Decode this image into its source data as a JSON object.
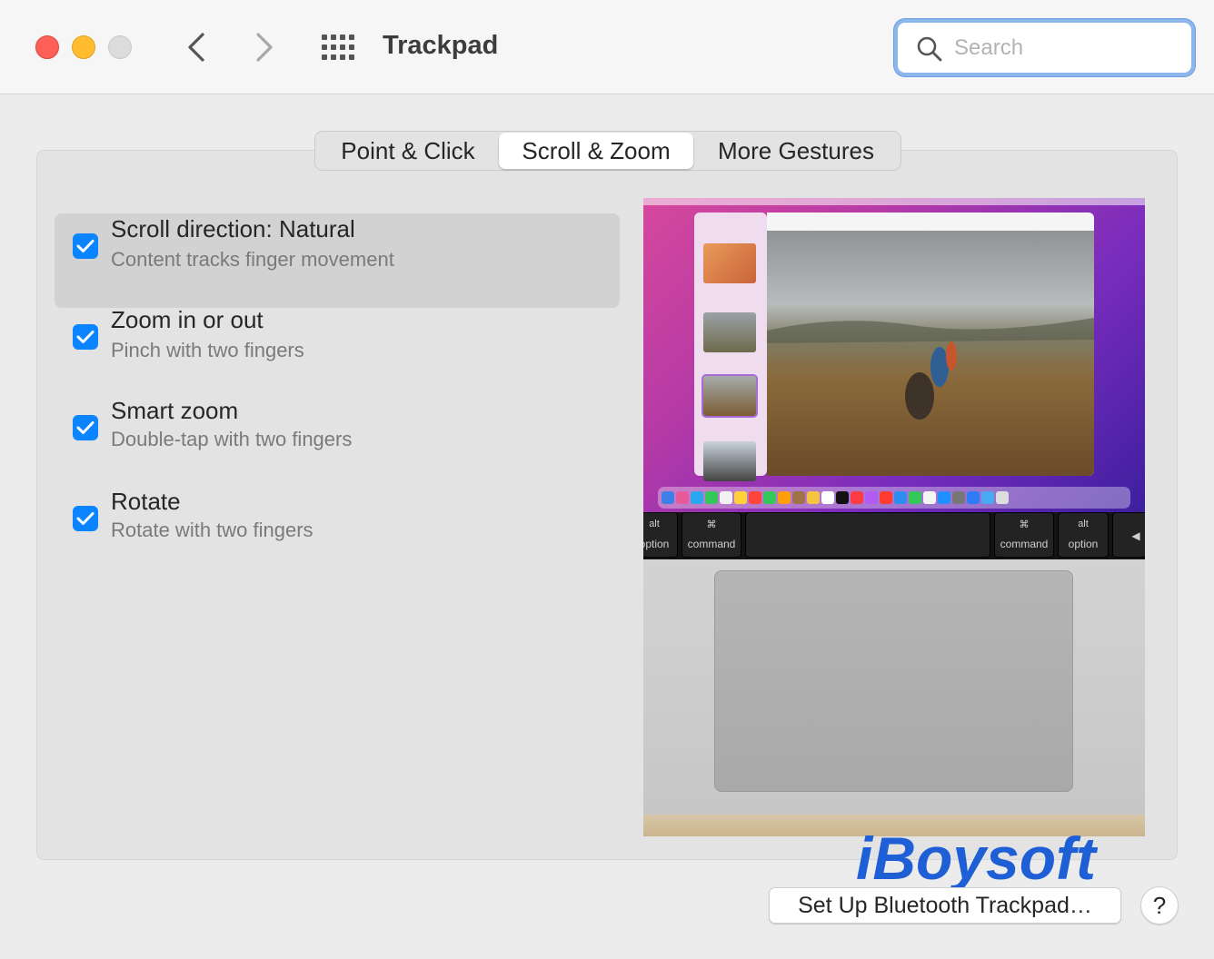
{
  "window": {
    "title": "Trackpad",
    "search": {
      "placeholder": "Search",
      "value": ""
    }
  },
  "tabs": [
    {
      "label": "Point & Click",
      "selected": false
    },
    {
      "label": "Scroll & Zoom",
      "selected": true
    },
    {
      "label": "More Gestures",
      "selected": false
    }
  ],
  "options": [
    {
      "title": "Scroll direction: Natural",
      "subtitle": "Content tracks finger movement",
      "checked": true,
      "selected": true
    },
    {
      "title": "Zoom in or out",
      "subtitle": "Pinch with two fingers",
      "checked": true,
      "selected": false
    },
    {
      "title": "Smart zoom",
      "subtitle": "Double-tap with two fingers",
      "checked": true,
      "selected": false
    },
    {
      "title": "Rotate",
      "subtitle": "Rotate with two fingers",
      "checked": true,
      "selected": false
    }
  ],
  "preview": {
    "keys": [
      {
        "top": "alt",
        "bottom": "option"
      },
      {
        "top": "⌘",
        "bottom": "command"
      },
      {
        "top": "⌘",
        "bottom": "command"
      },
      {
        "top": "alt",
        "bottom": "option"
      },
      {
        "top": "",
        "bottom": "◀"
      }
    ]
  },
  "watermark": "iBoysoft",
  "footer": {
    "setup_button": "Set Up Bluetooth Trackpad…",
    "help_button": "?"
  },
  "colors": {
    "accent": "#0a84ff",
    "watermark": "#1f5fd6",
    "close": "#fe5f57",
    "minimize": "#febc2e"
  },
  "icons": {
    "back": "chevron-left-icon",
    "forward": "chevron-right-icon",
    "all_prefs": "grid-icon",
    "search": "magnifier-icon",
    "check": "checkmark-icon"
  }
}
